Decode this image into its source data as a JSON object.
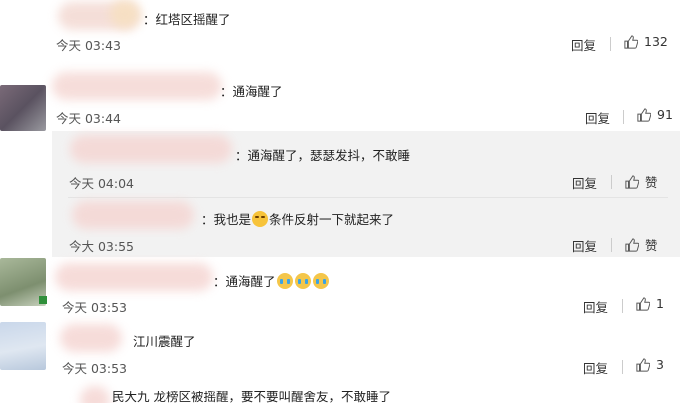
{
  "reply_label": "回复",
  "like_label_text": "赞",
  "comments": [
    {
      "text": "：红塔区摇醒了",
      "time": "今天 03:43",
      "likes": "132"
    },
    {
      "text": "：通海醒了",
      "time": "今天 03:44",
      "likes": "91"
    },
    {
      "text": "：通海醒了，瑟瑟发抖，不敢睡",
      "time": "今天 04:04",
      "likes": "赞"
    },
    {
      "text_a": "：我也是",
      "text_b": "条件反射一下就起来了",
      "time": "今大 03:55",
      "likes": "赞"
    },
    {
      "text": "：通海醒了",
      "time": "今天 03:53",
      "likes": "1"
    },
    {
      "text": "江川震醒了",
      "time": "今天 03:53",
      "likes": "3"
    }
  ],
  "truncated_last": "民大九 龙榜区被摇醒，要不要叫醒舍友，不敢睡了",
  "colors": {
    "avatar1": "#8a8a8a",
    "avatar2": "#6f6470",
    "avatar3": "#9aa58c",
    "avatar4": "#c6d2e3",
    "blur_pink": "#f3d4d0",
    "blur_peach": "#f7e2c9"
  }
}
